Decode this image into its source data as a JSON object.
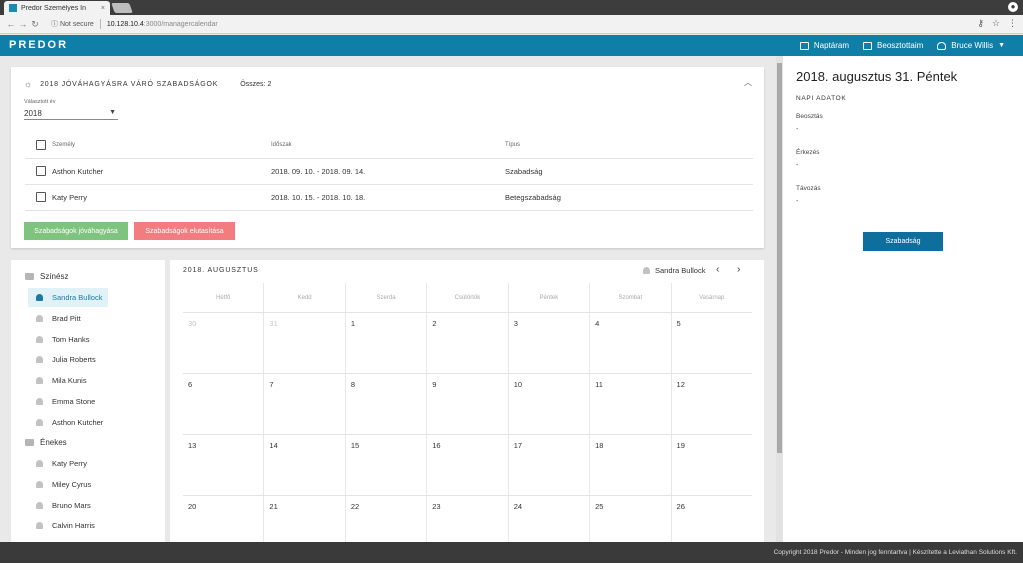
{
  "browser": {
    "tab_title": "Predor Személyes In",
    "tab_close": "×",
    "security": "Not secure",
    "url_host": "10.128.10.4",
    "url_path": ":3000/managercalendar"
  },
  "header": {
    "logo": "PREDOR",
    "nav": [
      {
        "label": "Naptáram",
        "icon": "calendar-icon"
      },
      {
        "label": "Beosztottaim",
        "icon": "org-chart-icon"
      },
      {
        "label": "Bruce Willis",
        "icon": "user-icon"
      }
    ]
  },
  "pending": {
    "title": "2018 JÓVÁHAGYÁSRA VÁRÓ SZABADSÁGOK",
    "total": "Összes: 2",
    "year_label": "Választott év",
    "year_value": "2018",
    "columns": [
      "Személy",
      "Időszak",
      "Típus"
    ],
    "rows": [
      {
        "name": "Asthon Kutcher",
        "period": "2018. 09. 10. - 2018. 09. 14.",
        "type": "Szabadság"
      },
      {
        "name": "Katy Perry",
        "period": "2018. 10. 15. - 2018. 10. 18.",
        "type": "Betegszabadság"
      }
    ],
    "approve_label": "Szabadságok jóváhagyása",
    "reject_label": "Szabadságok elutasítása"
  },
  "tree": {
    "groups": [
      {
        "name": "Színész",
        "members": [
          "Sandra Bullock",
          "Brad Pitt",
          "Tom Hanks",
          "Julia Roberts",
          "Mila Kunis",
          "Emma Stone",
          "Asthon Kutcher"
        ]
      },
      {
        "name": "Énekes",
        "members": [
          "Katy Perry",
          "Miley Cyrus",
          "Bruno Mars",
          "Calvin Harris"
        ]
      }
    ],
    "selected": "Sandra Bullock"
  },
  "calendar": {
    "title": "2018. AUGUSZTUS",
    "person": "Sandra Bullock",
    "weekdays": [
      "Hétfő",
      "Kedd",
      "Szerda",
      "Csütörtök",
      "Péntek",
      "Szombat",
      "Vasárnap"
    ],
    "weeks": [
      [
        "30",
        "31",
        "1",
        "2",
        "3",
        "4",
        "5"
      ],
      [
        "6",
        "7",
        "8",
        "9",
        "10",
        "11",
        "12"
      ],
      [
        "13",
        "14",
        "15",
        "16",
        "17",
        "18",
        "19"
      ],
      [
        "20",
        "21",
        "22",
        "23",
        "24",
        "25",
        "26"
      ]
    ]
  },
  "day_panel": {
    "date": "2018. augusztus 31. Péntek",
    "section": "NAPI ADATOK",
    "fields": [
      {
        "label": "Beosztás",
        "value": "-"
      },
      {
        "label": "Érkezés",
        "value": "-"
      },
      {
        "label": "Távozás",
        "value": "-"
      }
    ],
    "button_label": "Szabadság"
  },
  "footer": {
    "text": "Copyright 2018 Predor - Minden jog fenntartva | Készítette a Leviathan Solutions Kft."
  }
}
